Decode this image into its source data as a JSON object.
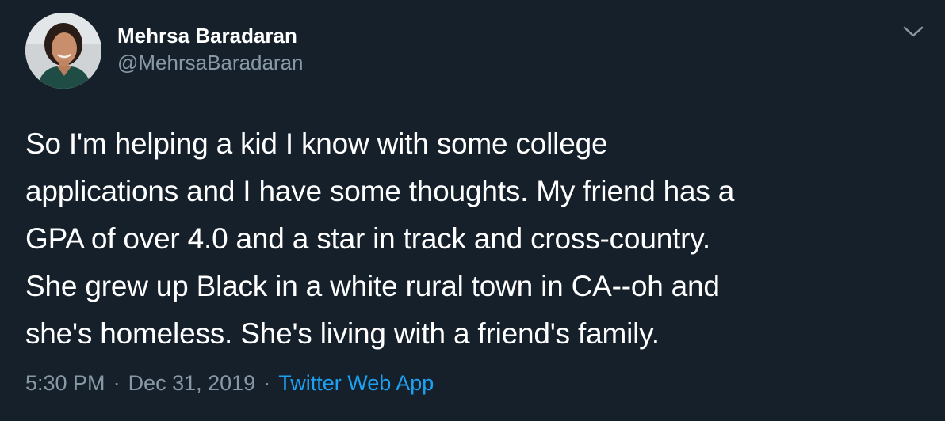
{
  "tweet": {
    "author": {
      "display_name": "Mehrsa Baradaran",
      "handle": "@MehrsaBaradaran",
      "avatar_icon": "profile-photo"
    },
    "text_lines": [
      "So I'm helping a kid I know with some college",
      "applications and I have some thoughts. My friend has a",
      "GPA of over 4.0 and a star in track and cross-country.",
      "She grew up Black in a white rural town in CA--oh and",
      "she's homeless. She's living with a friend's family."
    ],
    "time": "5:30 PM",
    "date": "Dec 31, 2019",
    "separator": "·",
    "source": "Twitter Web App",
    "menu_icon": "chevron-down-icon"
  },
  "colors": {
    "background": "#15202b",
    "primary_text": "#ffffff",
    "secondary_text": "#8899a6",
    "link": "#1da1f2"
  }
}
